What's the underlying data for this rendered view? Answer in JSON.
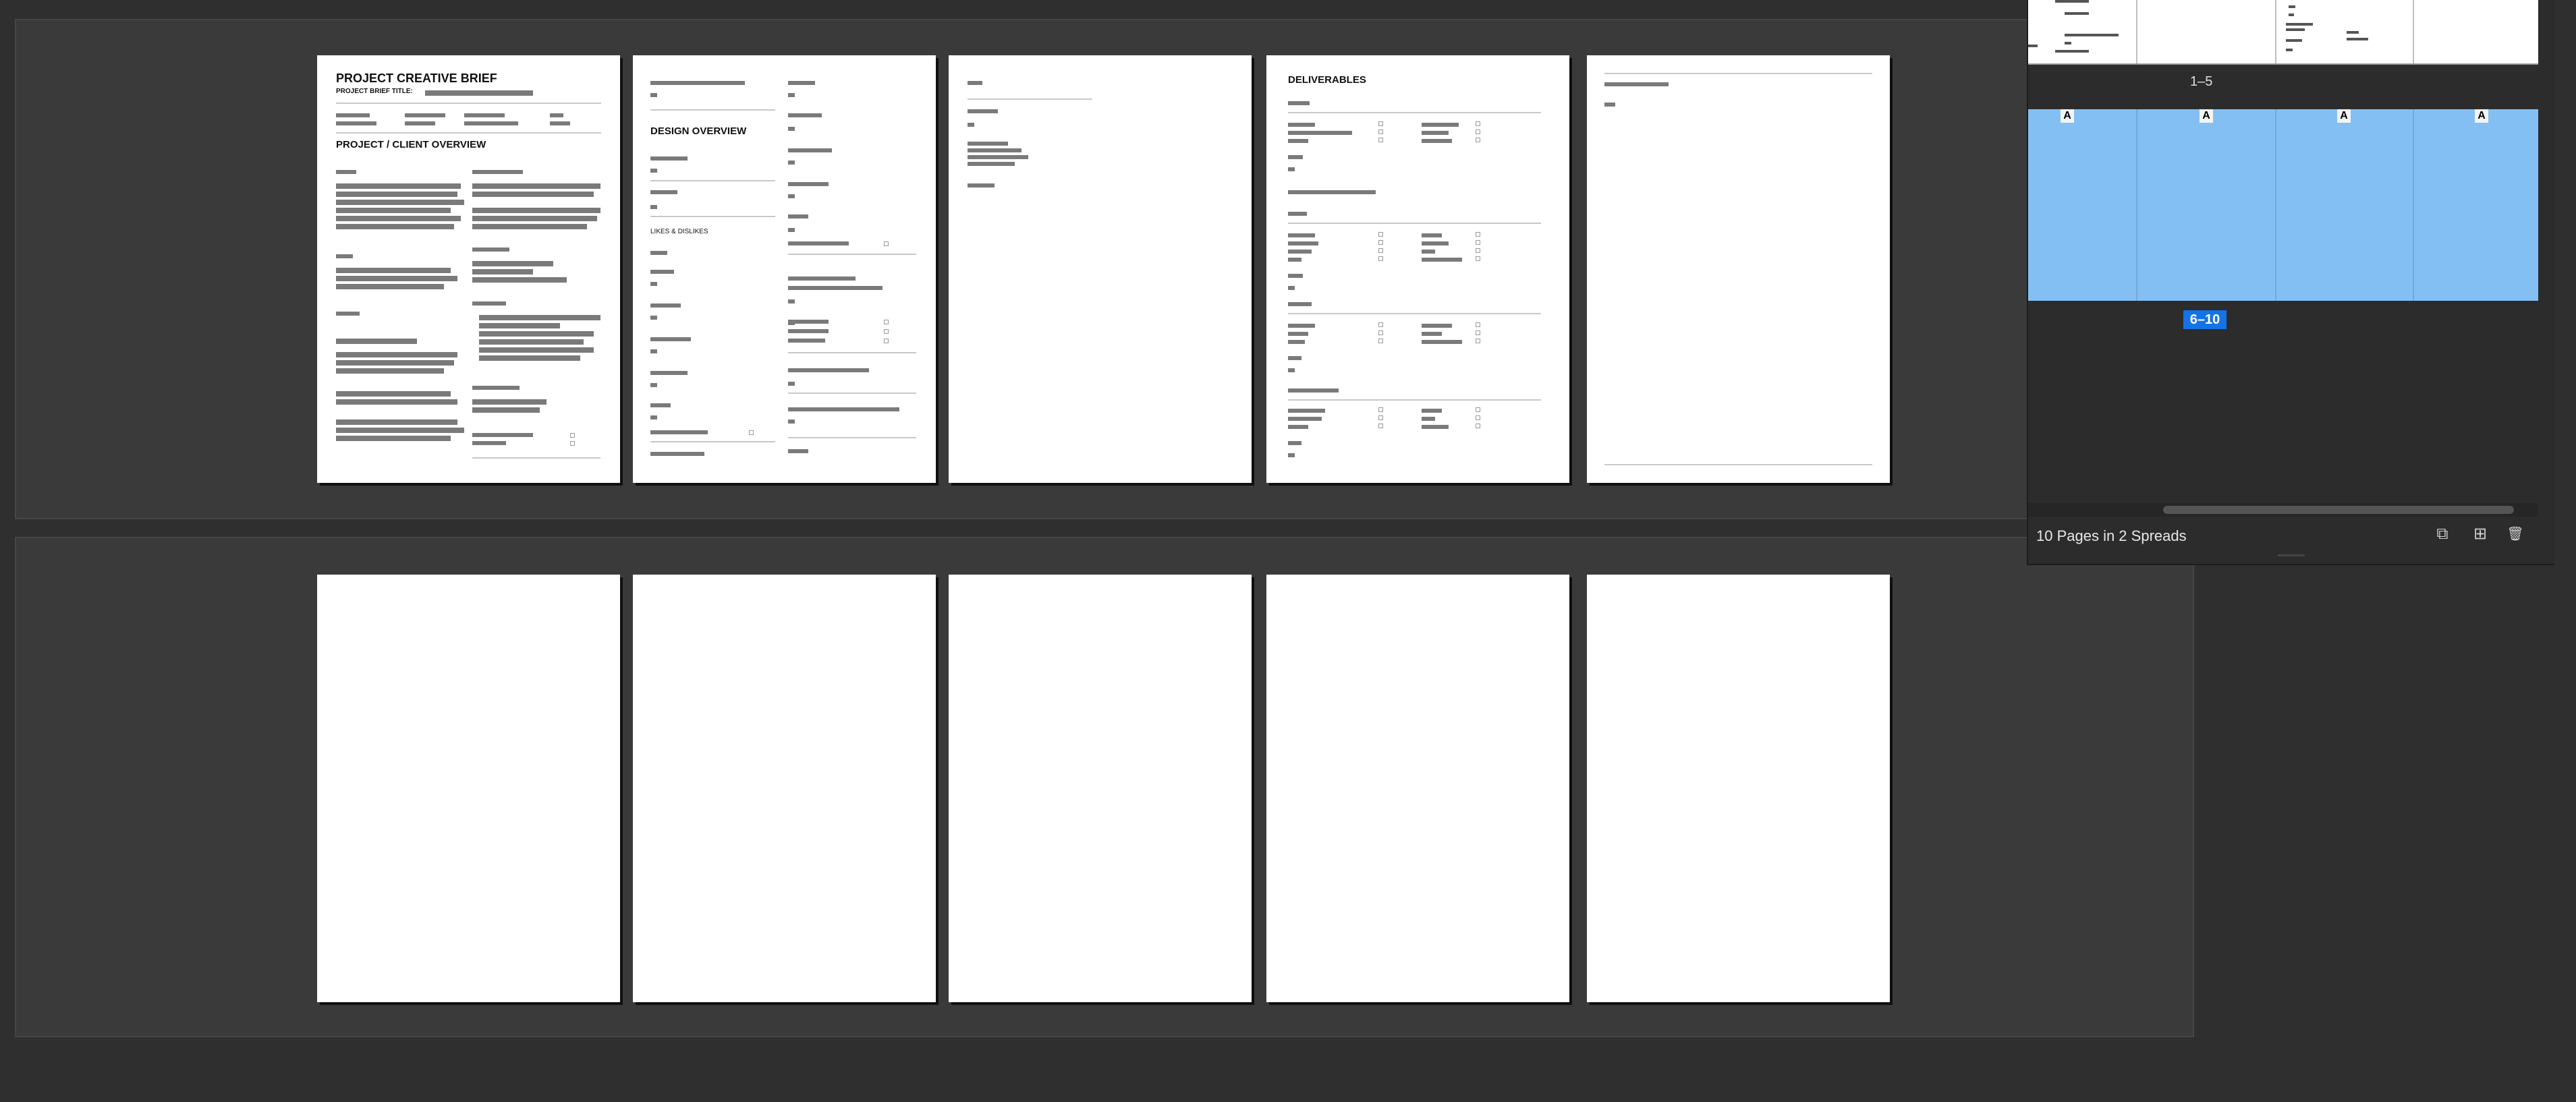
{
  "pages_row1": {
    "page1": {
      "title": "PROJECT CREATIVE BRIEF",
      "subtitle": "PROJECT BRIEF TITLE:",
      "section": "PROJECT / CLIENT OVERVIEW"
    },
    "page2": {
      "section": "DESIGN OVERVIEW",
      "subsection": "LIKES & DISLIKES"
    },
    "page4": {
      "section": "DELIVERABLES"
    }
  },
  "pages_panel": {
    "spread1_label": "1–5",
    "spread2_label": "6–10",
    "master_letters": [
      "A",
      "A",
      "A",
      "A"
    ],
    "summary": "10 Pages in 2 Spreads",
    "buttons": {
      "edit_page_size": "⧉",
      "new_page": "⊞",
      "delete_page": "🗑"
    }
  }
}
